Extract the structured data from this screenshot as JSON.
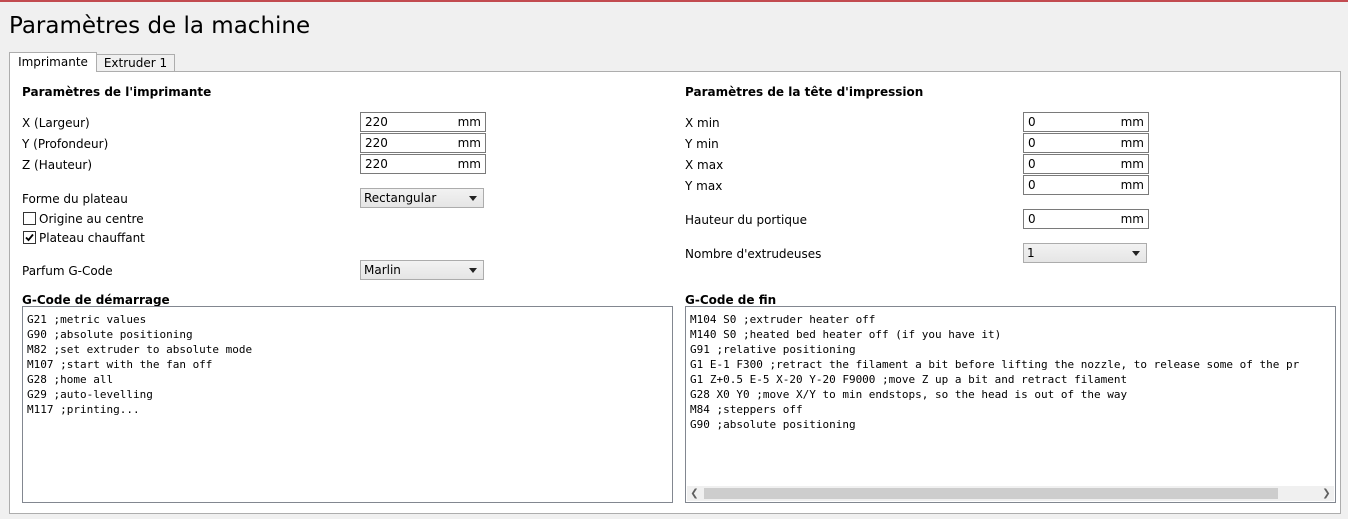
{
  "window": {
    "title": "Paramètres de la machine"
  },
  "tabs": [
    {
      "label": "Imprimante",
      "active": true
    },
    {
      "label": "Extruder 1",
      "active": false
    }
  ],
  "printer": {
    "heading": "Paramètres de l'imprimante",
    "x": {
      "label": "X (Largeur)",
      "value": "220",
      "unit": "mm"
    },
    "y": {
      "label": "Y (Profondeur)",
      "value": "220",
      "unit": "mm"
    },
    "z": {
      "label": "Z (Hauteur)",
      "value": "220",
      "unit": "mm"
    },
    "bed_shape": {
      "label": "Forme du plateau",
      "value": "Rectangular"
    },
    "origin_center": {
      "label": "Origine au centre",
      "checked": false
    },
    "heated_bed": {
      "label": "Plateau chauffant",
      "checked": true
    },
    "gcode_flavor": {
      "label": "Parfum G-Code",
      "value": "Marlin"
    }
  },
  "printhead": {
    "heading": "Paramètres de la tête d'impression",
    "x_min": {
      "label": "X min",
      "value": "0",
      "unit": "mm"
    },
    "y_min": {
      "label": "Y min",
      "value": "0",
      "unit": "mm"
    },
    "x_max": {
      "label": "X max",
      "value": "0",
      "unit": "mm"
    },
    "y_max": {
      "label": "Y max",
      "value": "0",
      "unit": "mm"
    },
    "gantry_height": {
      "label": "Hauteur du portique",
      "value": "0",
      "unit": "mm"
    },
    "extruder_count": {
      "label": "Nombre d'extrudeuses",
      "value": "1"
    }
  },
  "start_gcode": {
    "heading": "G-Code de démarrage",
    "lines": [
      "G21 ;metric values",
      "G90 ;absolute positioning",
      "M82 ;set extruder to absolute mode",
      "M107 ;start with the fan off",
      "G28 ;home all",
      "G29 ;auto-levelling",
      "M117 ;printing..."
    ]
  },
  "end_gcode": {
    "heading": "G-Code de fin",
    "lines": [
      "M104 S0 ;extruder heater off",
      "M140 S0 ;heated bed heater off (if you have it)",
      "G91 ;relative positioning",
      "G1 E-1 F300 ;retract the filament a bit before lifting the nozzle, to release some of the pr",
      "G1 Z+0.5 E-5 X-20 Y-20 F9000 ;move Z up a bit and retract filament",
      "G28 X0 Y0 ;move X/Y to min endstops, so the head is out of the way",
      "M84 ;steppers off",
      "G90 ;absolute positioning"
    ]
  }
}
